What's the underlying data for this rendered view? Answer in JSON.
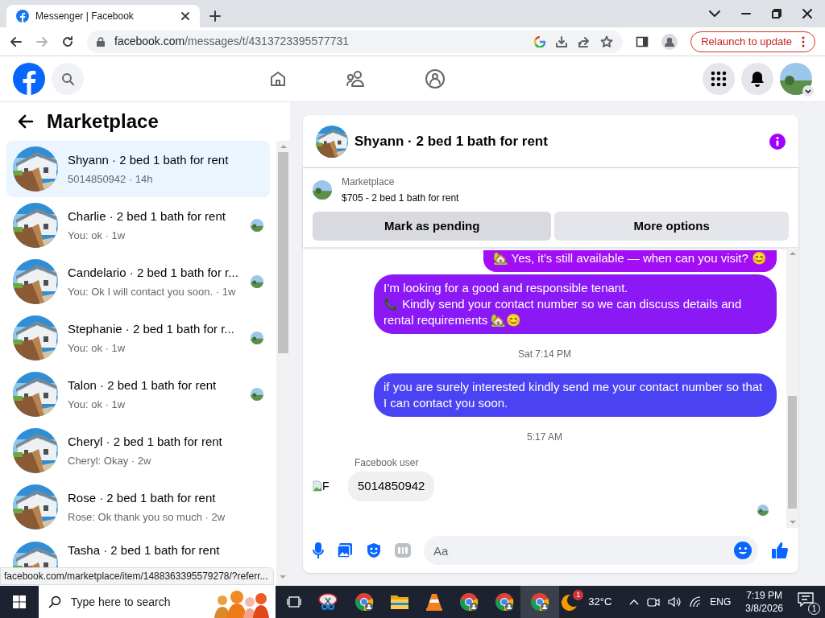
{
  "browser": {
    "tab_title": "Messenger | Facebook",
    "url_host": "facebook.com",
    "url_path": "/messages/t/4313723395577731",
    "relaunch": "Relaunch to update"
  },
  "sidebar": {
    "title": "Marketplace",
    "conversations": [
      {
        "title": "Shyann · 2 bed 1 bath for rent",
        "preview": "5014850942 · 14h",
        "selected": true,
        "seen": false
      },
      {
        "title": "Charlie · 2 bed 1 bath for rent",
        "preview": "You: ok · 1w",
        "selected": false,
        "seen": true
      },
      {
        "title": "Candelario · 2 bed 1 bath for r...",
        "preview": "You: Ok I will contact you soon. · 1w",
        "selected": false,
        "seen": true
      },
      {
        "title": "Stephanie · 2 bed 1 bath for r...",
        "preview": "You: ok · 1w",
        "selected": false,
        "seen": true
      },
      {
        "title": "Talon · 2 bed 1 bath for rent",
        "preview": "You: ok · 1w",
        "selected": false,
        "seen": true
      },
      {
        "title": "Cheryl · 2 bed 1 bath for rent",
        "preview": "Cheryl: Okay · 2w",
        "selected": false,
        "seen": false
      },
      {
        "title": "Rose · 2 bed 1 bath for rent",
        "preview": "Rose: Ok thank you so much · 2w",
        "selected": false,
        "seen": false
      },
      {
        "title": "Tasha · 2 bed 1 bath for rent",
        "selected": false
      }
    ]
  },
  "status_url": "facebook.com/marketplace/item/1488363395579278/?referr...",
  "chat": {
    "title": "Shyann · 2 bed 1 bath for rent",
    "listing": {
      "label": "Marketplace",
      "title": "$705 - 2 bed 1 bath for rent"
    },
    "actions": [
      "Mark as pending",
      "More options"
    ],
    "messages": [
      {
        "kind": "outgoing",
        "text": "🏡 Yes, it’s still available — when can you visit? 😊",
        "color": "#a20ef5"
      },
      {
        "kind": "outgoing",
        "text": "I’m looking for a good and responsible tenant.\n📞 Kindly send your contact number so we can discuss details and rental requirements 🏡😊",
        "color": "#8a19f6"
      },
      {
        "kind": "time",
        "text": "Sat 7:14 PM"
      },
      {
        "kind": "outgoing",
        "text": "if you are surely interested kindly send me your contact number so that I can contact you soon.",
        "color": "#4b43f3"
      },
      {
        "kind": "time",
        "text": "5:17 AM"
      },
      {
        "kind": "incoming",
        "sender": "Facebook user",
        "avatar_alt": "F",
        "text": "5014850942"
      }
    ],
    "composer": {
      "placeholder": "Aa"
    }
  },
  "taskbar": {
    "search_placeholder": "Type here to search",
    "weather_badge": "1",
    "temperature": "32°C",
    "language": "ENG",
    "time": "7:19 PM",
    "date": "3/8/2026",
    "notifications": "1"
  }
}
